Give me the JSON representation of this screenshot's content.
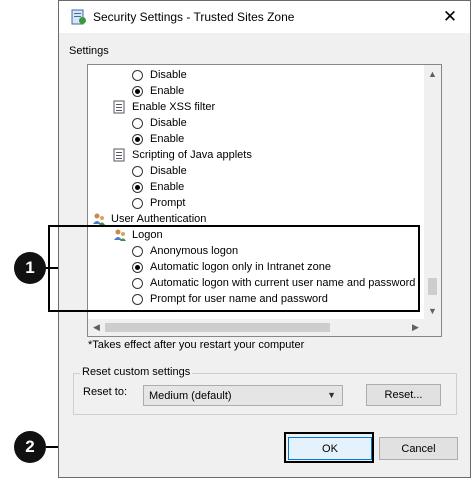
{
  "window": {
    "title": "Security Settings - Trusted Sites Zone",
    "close_glyph": "✕"
  },
  "settings_group": {
    "label": "Settings"
  },
  "tree": {
    "row1": "Disable",
    "row2": "Enable",
    "xss_label": "Enable XSS filter",
    "xss_disable": "Disable",
    "xss_enable": "Enable",
    "java_label": "Scripting of Java applets",
    "java_disable": "Disable",
    "java_enable": "Enable",
    "java_prompt": "Prompt",
    "user_auth_label": "User Authentication",
    "logon_label": "Logon",
    "logon_anon": "Anonymous logon",
    "logon_auto_intranet": "Automatic logon only in Intranet zone",
    "logon_auto_current": "Automatic logon with current user name and password",
    "logon_prompt": "Prompt for user name and password"
  },
  "selected": {
    "row_enable": true,
    "xss": "Enable",
    "java": "Enable",
    "logon": "Automatic logon only in Intranet zone"
  },
  "footnote": "*Takes effect after you restart your computer",
  "reset_group": {
    "label": "Reset custom settings",
    "reset_to_label": "Reset to:",
    "reset_to_value": "Medium (default)",
    "reset_button": "Reset..."
  },
  "buttons": {
    "ok": "OK",
    "cancel": "Cancel"
  },
  "callouts": {
    "one": "1",
    "two": "2"
  },
  "colors": {
    "focus_border": "#3c7fb1",
    "callout_bg": "#111111"
  }
}
